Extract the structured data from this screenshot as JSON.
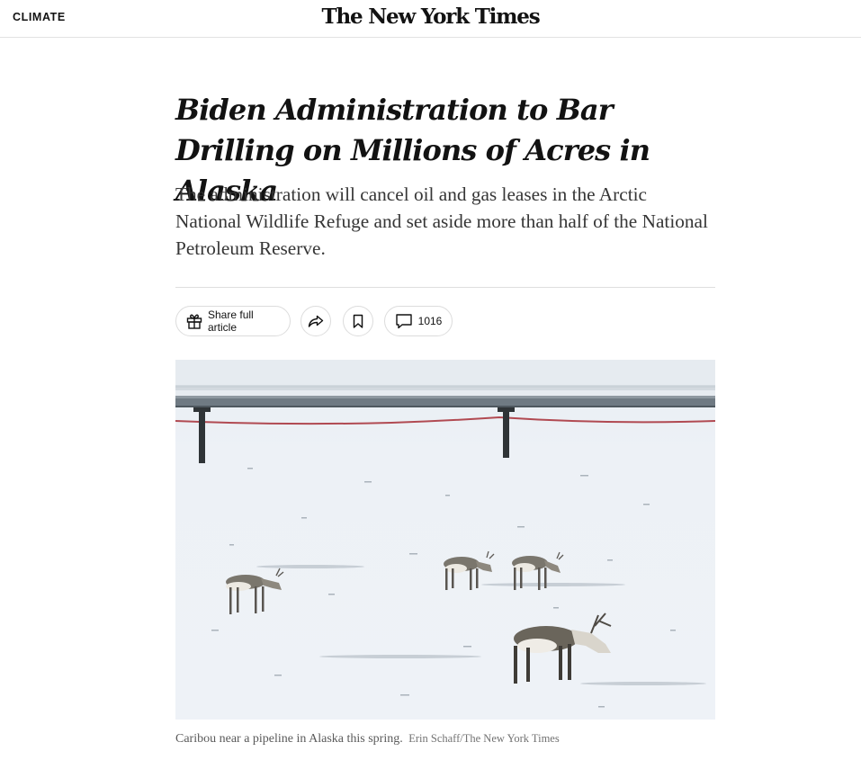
{
  "header": {
    "section_label": "CLIMATE",
    "masthead": "The New York Times"
  },
  "article": {
    "headline": "Biden Administration to Bar Drilling on Millions of Acres in Alaska",
    "summary": "The administration will cancel oil and gas leases in the Arctic National Wildlife Refuge and set aside more than half of the National Petroleum Reserve."
  },
  "actions": {
    "share_full_label": "Share full article",
    "comment_count": "1016",
    "icons": {
      "share_full": "gift-icon",
      "share": "share-arrow-icon",
      "save": "bookmark-icon",
      "comments": "comment-bubble-icon"
    }
  },
  "image": {
    "caption": "Caribou near a pipeline in Alaska this spring.",
    "credit": "Erin Schaff/The New York Times"
  }
}
